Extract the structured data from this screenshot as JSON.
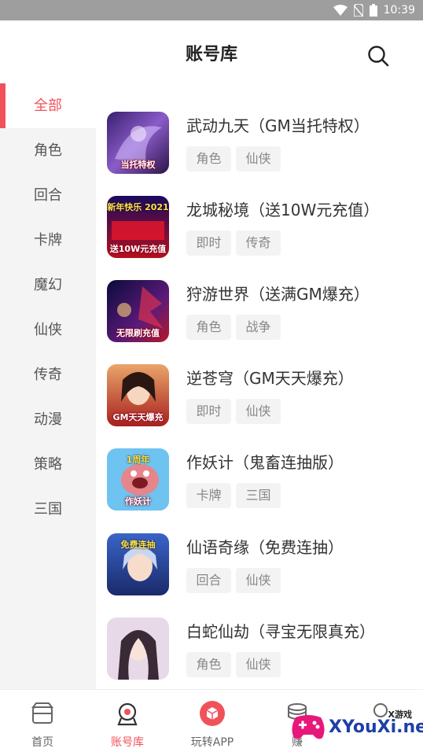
{
  "status_bar": {
    "time": "10:39"
  },
  "header": {
    "title": "账号库"
  },
  "sidebar": {
    "items": [
      {
        "label": "全部",
        "active": true
      },
      {
        "label": "角色"
      },
      {
        "label": "回合"
      },
      {
        "label": "卡牌"
      },
      {
        "label": "魔幻"
      },
      {
        "label": "仙侠"
      },
      {
        "label": "传奇"
      },
      {
        "label": "动漫"
      },
      {
        "label": "策略"
      },
      {
        "label": "三国"
      }
    ]
  },
  "games": [
    {
      "name": "武动九天（GM当托特权）",
      "tags": [
        "角色",
        "仙侠"
      ],
      "thumb_text": "当托特权",
      "thumb_top": ""
    },
    {
      "name": "龙城秘境（送10W元充值）",
      "tags": [
        "即时",
        "传奇"
      ],
      "thumb_text": "送10W元充值",
      "thumb_top": "新年快乐 2021"
    },
    {
      "name": "狩游世界（送满GM爆充）",
      "tags": [
        "角色",
        "战争"
      ],
      "thumb_text": "无限刷充值",
      "thumb_top": ""
    },
    {
      "name": "逆苍穹（GM天天爆充）",
      "tags": [
        "即时",
        "仙侠"
      ],
      "thumb_text": "GM天天爆充",
      "thumb_top": ""
    },
    {
      "name": "作妖计（鬼畜连抽版）",
      "tags": [
        "卡牌",
        "三国"
      ],
      "thumb_text": "作妖计",
      "thumb_top": "1周年"
    },
    {
      "name": "仙语奇缘（免费连抽）",
      "tags": [
        "回合",
        "仙侠"
      ],
      "thumb_text": "",
      "thumb_top": "免费连抽"
    },
    {
      "name": "白蛇仙劫（寻宝无限真充）",
      "tags": [
        "角色",
        "仙侠"
      ],
      "thumb_text": "",
      "thumb_top": ""
    }
  ],
  "bottom_nav": {
    "items": [
      {
        "label": "首页",
        "icon": "home-icon"
      },
      {
        "label": "账号库",
        "icon": "account-library-icon",
        "active": true
      },
      {
        "label": "玩转APP",
        "icon": "play-app-icon"
      },
      {
        "label": "赚",
        "icon": "coins-icon"
      },
      {
        "label": "",
        "icon": "profile-icon"
      }
    ]
  },
  "watermark": {
    "small": "X游戏",
    "main": "XYouXi.net"
  },
  "colors": {
    "accent": "#f0525a",
    "sidebar_bg": "#f4f4f4",
    "tag_bg": "#f3f3f3"
  }
}
